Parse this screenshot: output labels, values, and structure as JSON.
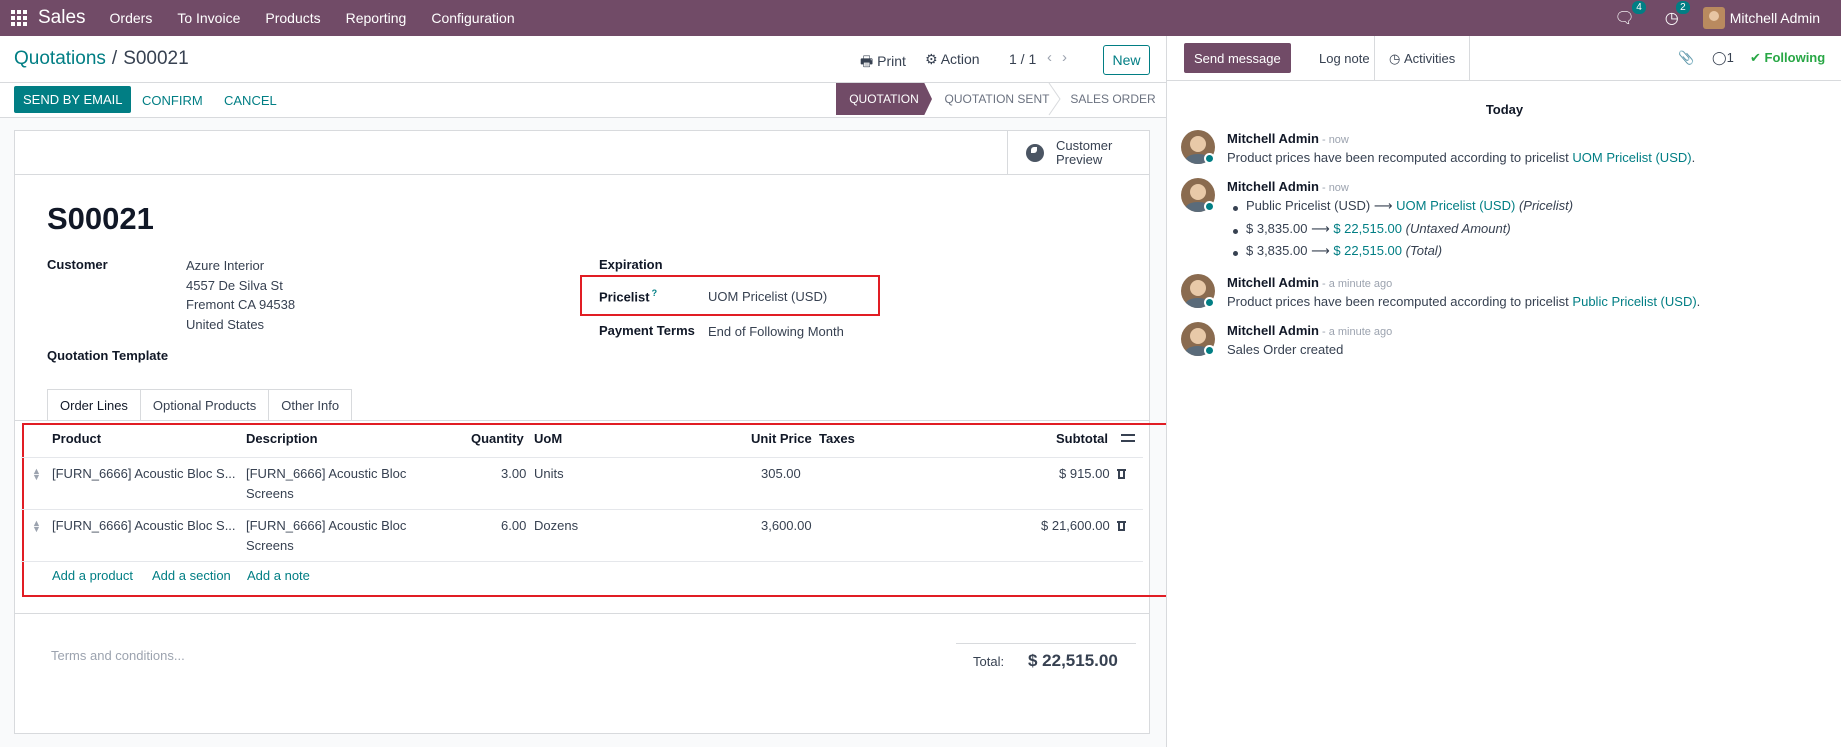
{
  "navbar": {
    "app_name": "Sales",
    "menu": [
      "Orders",
      "To Invoice",
      "Products",
      "Reporting",
      "Configuration"
    ],
    "messages_count": "4",
    "activities_count": "2",
    "user_name": "Mitchell Admin",
    "brand_color": "#714b67"
  },
  "control_panel": {
    "breadcrumb_parent": "Quotations",
    "breadcrumb_current": "S00021",
    "print_label": "Print",
    "action_label": "Action",
    "pager": "1 / 1",
    "new_label": "New"
  },
  "statusbar": {
    "send_email_label": "SEND BY EMAIL",
    "confirm_label": "CONFIRM",
    "cancel_label": "CANCEL",
    "stages": [
      "QUOTATION",
      "QUOTATION SENT",
      "SALES ORDER"
    ],
    "active_stage": "QUOTATION"
  },
  "form": {
    "customer_preview_line1": "Customer",
    "customer_preview_line2": "Preview",
    "title": "S00021",
    "customer_label": "Customer",
    "customer_name": "Azure Interior",
    "address_line1": "4557 De Silva St",
    "address_line2": "Fremont CA 94538",
    "address_line3": "United States",
    "quotation_template_label": "Quotation Template",
    "expiration_label": "Expiration",
    "pricelist_label": "Pricelist",
    "pricelist_tip": "?",
    "pricelist_value": "UOM Pricelist (USD)",
    "payment_terms_label": "Payment Terms",
    "payment_terms_value": "End of Following Month",
    "tabs": [
      "Order Lines",
      "Optional Products",
      "Other Info"
    ],
    "columns": {
      "product": "Product",
      "description": "Description",
      "quantity": "Quantity",
      "uom": "UoM",
      "unit_price": "Unit Price",
      "taxes": "Taxes",
      "subtotal": "Subtotal"
    },
    "lines": [
      {
        "product": "[FURN_6666] Acoustic Bloc S...",
        "description_1": "[FURN_6666] Acoustic Bloc",
        "description_2": "Screens",
        "quantity": "3.00",
        "uom": "Units",
        "unit_price": "305.00",
        "subtotal": "$ 915.00"
      },
      {
        "product": "[FURN_6666] Acoustic Bloc S...",
        "description_1": "[FURN_6666] Acoustic Bloc",
        "description_2": "Screens",
        "quantity": "6.00",
        "uom": "Dozens",
        "unit_price": "3,600.00",
        "subtotal": "$ 21,600.00"
      }
    ],
    "add_product": "Add a product",
    "add_section": "Add a section",
    "add_note": "Add a note",
    "terms_placeholder": "Terms and conditions...",
    "total_label": "Total:",
    "total_value": "$ 22,515.00"
  },
  "chatter": {
    "send_message": "Send message",
    "log_note": "Log note",
    "activities": "Activities",
    "followers_count": "1",
    "following": "Following",
    "date_separator": "Today",
    "messages": [
      {
        "author": "Mitchell Admin",
        "time": "- now",
        "text": "Product prices have been recomputed according to pricelist ",
        "link": "UOM Pricelist (USD)",
        "suffix": "."
      },
      {
        "author": "Mitchell Admin",
        "time": "- now",
        "tracking": [
          {
            "old": "Public Pricelist (USD)",
            "new": "UOM Pricelist (USD)",
            "field": "(Pricelist)"
          },
          {
            "old": "$ 3,835.00",
            "new": "$ 22,515.00",
            "field": "(Untaxed Amount)"
          },
          {
            "old": "$ 3,835.00",
            "new": "$ 22,515.00",
            "field": "(Total)"
          }
        ]
      },
      {
        "author": "Mitchell Admin",
        "time": "- a minute ago",
        "text": "Product prices have been recomputed according to pricelist ",
        "link": "Public Pricelist (USD)",
        "suffix": "."
      },
      {
        "author": "Mitchell Admin",
        "time": "- a minute ago",
        "text": "Sales Order created"
      }
    ]
  }
}
